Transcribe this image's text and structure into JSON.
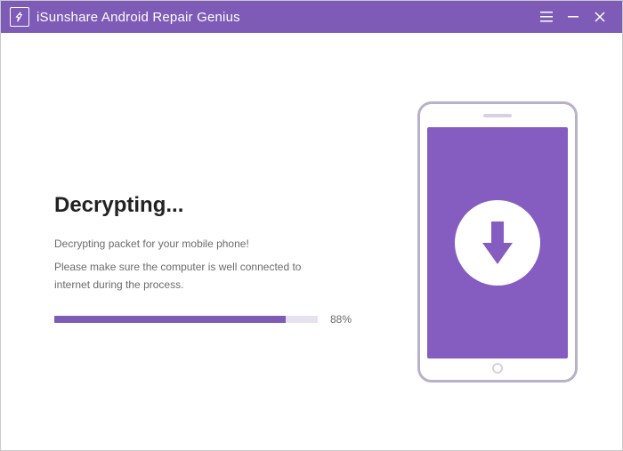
{
  "titlebar": {
    "title": "iSunshare Android Repair Genius"
  },
  "main": {
    "heading": "Decrypting...",
    "line1": "Decrypting packet for your mobile phone!",
    "line2": "Please make sure the computer is well connected to internet during the process.",
    "progress_percent": 88,
    "progress_label": "88%"
  },
  "colors": {
    "accent": "#7e5bb7",
    "screen": "#855dc1"
  }
}
